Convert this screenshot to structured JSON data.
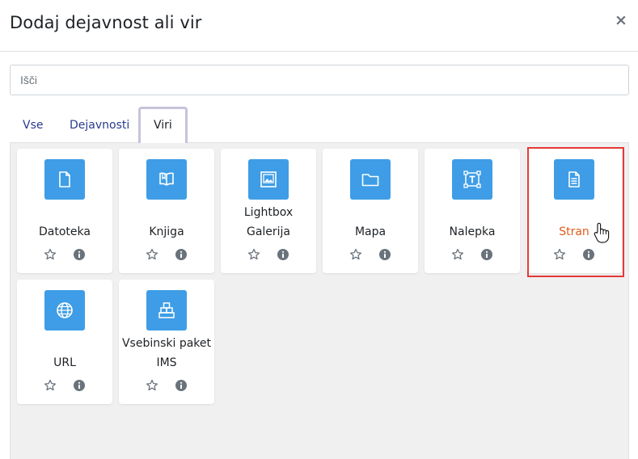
{
  "dialog": {
    "title": "Dodaj dejavnost ali vir",
    "close_symbol": "×"
  },
  "search": {
    "placeholder": "Išči",
    "value": ""
  },
  "tabs": [
    {
      "label": "Vse",
      "active": false
    },
    {
      "label": "Dejavnosti",
      "active": false
    },
    {
      "label": "Viri",
      "active": true
    }
  ],
  "items": [
    {
      "line1": "Datoteka",
      "line2": "",
      "icon": "file-icon"
    },
    {
      "line1": "Knjiga",
      "line2": "",
      "icon": "book-icon"
    },
    {
      "line1": "Lightbox",
      "line2": "Galerija",
      "icon": "gallery-icon"
    },
    {
      "line1": "Mapa",
      "line2": "",
      "icon": "folder-icon"
    },
    {
      "line1": "Nalepka",
      "line2": "",
      "icon": "label-icon"
    },
    {
      "line1": "Stran",
      "line2": "",
      "icon": "page-icon",
      "highlighted": true
    },
    {
      "line1": "URL",
      "line2": "",
      "icon": "globe-icon"
    },
    {
      "line1": "Vsebinski paket",
      "line2": "IMS",
      "icon": "package-icon"
    }
  ],
  "colors": {
    "icon_bg": "#3e9de6",
    "tab_link": "#2a3a8c",
    "highlight_border": "#e53935",
    "hover_text": "#e35a17",
    "panel_bg": "#f0f0f0"
  }
}
